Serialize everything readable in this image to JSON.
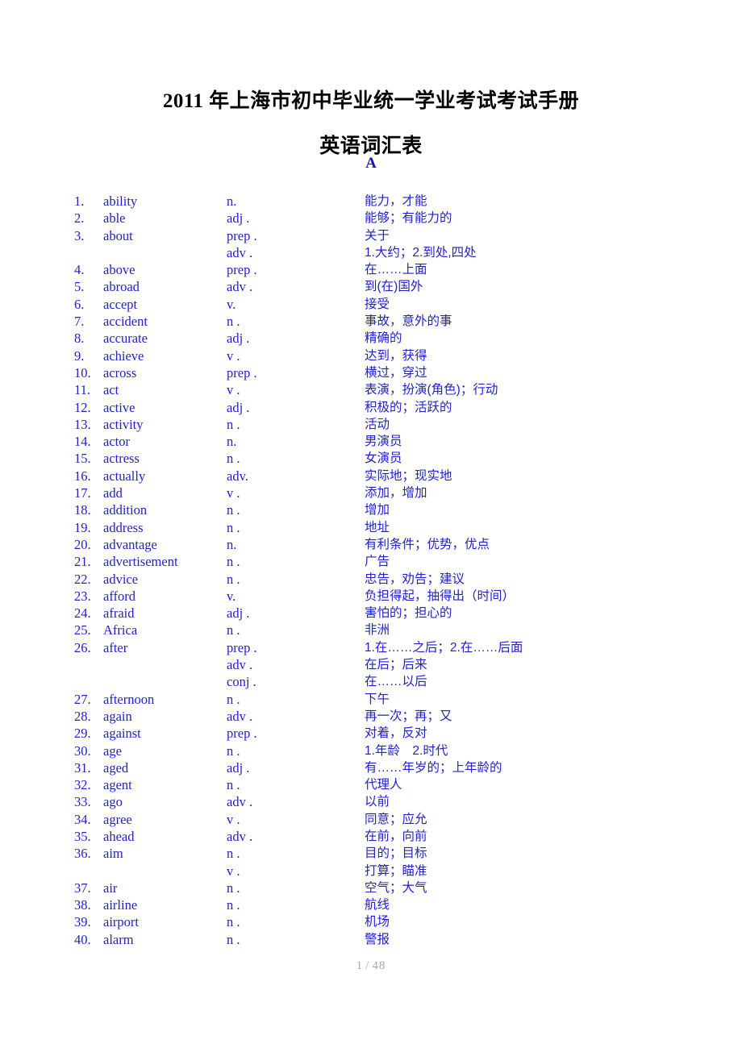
{
  "document": {
    "title": "2011 年上海市初中毕业统一学业考试考试手册",
    "subtitle": "英语词汇表",
    "section_letter": "A",
    "footer": {
      "current_page": "1",
      "separator": "/",
      "total_pages": "48"
    },
    "colors": {
      "text_blue": "#2222cc",
      "heading_blue": "#1414cc",
      "title_black": "#000000",
      "footer_gray": "#a8a8a8"
    }
  },
  "entries": [
    {
      "num": "1.",
      "word": "ability",
      "pos": "n.",
      "def": "能力，才能"
    },
    {
      "num": "2.",
      "word": "able",
      "pos": "adj .",
      "def": "能够；有能力的"
    },
    {
      "num": "3.",
      "word": "about",
      "pos": "prep .",
      "def": "关于"
    },
    {
      "num": "",
      "word": "",
      "pos": "adv .",
      "def": "1.大约；2.到处,四处"
    },
    {
      "num": "4.",
      "word": "above",
      "pos": "prep .",
      "def": "在……上面"
    },
    {
      "num": "5.",
      "word": "abroad",
      "pos": "adv .",
      "def": "到(在)国外"
    },
    {
      "num": "6.",
      "word": "accept",
      "pos": "v.",
      "def": "接受"
    },
    {
      "num": "7.",
      "word": "accident",
      "pos": "n .",
      "def": "事故，意外的事"
    },
    {
      "num": "8.",
      "word": "accurate",
      "pos": "adj .",
      "def": "精确的"
    },
    {
      "num": "9.",
      "word": "achieve",
      "pos": "v .",
      "def": "达到，获得"
    },
    {
      "num": "10.",
      "word": "across",
      "pos": "prep .",
      "def": "横过，穿过"
    },
    {
      "num": "11.",
      "word": "act",
      "pos": "v .",
      "def": "表演，扮演(角色)；行动"
    },
    {
      "num": "12.",
      "word": "active",
      "pos": "adj .",
      "def": "积极的；活跃的"
    },
    {
      "num": "13.",
      "word": "activity",
      "pos": "n .",
      "def": "活动"
    },
    {
      "num": "14.",
      "word": "actor",
      "pos": "n.",
      "def": "男演员"
    },
    {
      "num": "15.",
      "word": "actress",
      "pos": "n .",
      "def": "女演员"
    },
    {
      "num": "16.",
      "word": "actually",
      "pos": "adv.",
      "def": "实际地；现实地"
    },
    {
      "num": "17.",
      "word": "add",
      "pos": "v .",
      "def": "添加，增加"
    },
    {
      "num": "18.",
      "word": "addition",
      "pos": "n .",
      "def": "增加"
    },
    {
      "num": "19.",
      "word": "address",
      "pos": "n .",
      "def": "地址"
    },
    {
      "num": "20.",
      "word": "advantage",
      "pos": "n.",
      "def": "有利条件；优势，优点"
    },
    {
      "num": "21.",
      "word": "advertisement",
      "pos": "n .",
      "def": "广告"
    },
    {
      "num": "22.",
      "word": "advice",
      "pos": "n .",
      "def": "忠告，劝告；建议"
    },
    {
      "num": "23.",
      "word": "afford",
      "pos": "v.",
      "def": "负担得起，抽得出（时间）"
    },
    {
      "num": "24.",
      "word": "afraid",
      "pos": "adj .",
      "def": "害怕的；担心的"
    },
    {
      "num": "25.",
      "word": "Africa",
      "pos": "n .",
      "def": "非洲"
    },
    {
      "num": "26.",
      "word": "after",
      "pos": "prep .",
      "def": "1.在……之后；2.在……后面"
    },
    {
      "num": "",
      "word": "",
      "pos": "adv .",
      "def": "在后；后来"
    },
    {
      "num": "",
      "word": "",
      "pos": "conj .",
      "def": "在……以后"
    },
    {
      "num": "27.",
      "word": "afternoon",
      "pos": "n .",
      "def": "下午"
    },
    {
      "num": "28.",
      "word": "again",
      "pos": "adv .",
      "def": "再一次；再；又"
    },
    {
      "num": "29.",
      "word": "against",
      "pos": "prep .",
      "def": "对着，反对"
    },
    {
      "num": "30.",
      "word": "age",
      "pos": "n .",
      "def": "1.年龄　2.时代"
    },
    {
      "num": "31.",
      "word": "aged",
      "pos": "adj .",
      "def": "有……年岁的；上年龄的"
    },
    {
      "num": "32.",
      "word": "agent",
      "pos": "n .",
      "def": "代理人"
    },
    {
      "num": "33.",
      "word": "ago",
      "pos": "adv .",
      "def": "以前"
    },
    {
      "num": "34.",
      "word": "agree",
      "pos": "v .",
      "def": "同意；应允"
    },
    {
      "num": "35.",
      "word": "ahead",
      "pos": "adv .",
      "def": "在前，向前"
    },
    {
      "num": "36.",
      "word": "aim",
      "pos": "n .",
      "def": "目的；目标"
    },
    {
      "num": "",
      "word": "",
      "pos": "v .",
      "def": "打算；瞄准"
    },
    {
      "num": "37.",
      "word": "air",
      "pos": "n .",
      "def": "空气；大气"
    },
    {
      "num": "38.",
      "word": "airline",
      "pos": "n .",
      "def": "航线"
    },
    {
      "num": "39.",
      "word": "airport",
      "pos": "n .",
      "def": "机场"
    },
    {
      "num": "40.",
      "word": "alarm",
      "pos": "n .",
      "def": "警报"
    }
  ]
}
